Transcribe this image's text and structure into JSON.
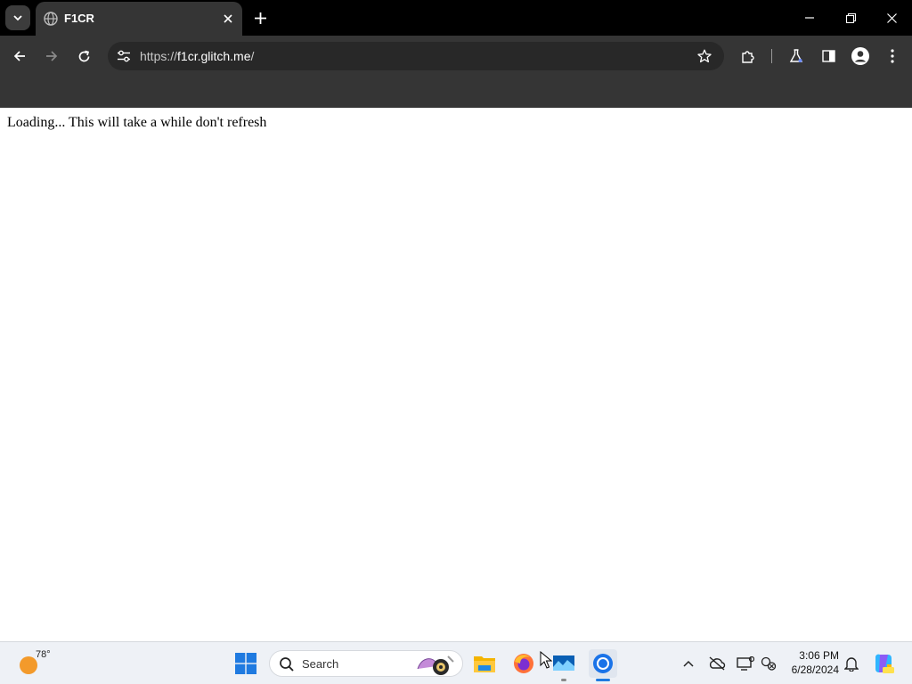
{
  "browser": {
    "tab": {
      "title": "F1CR"
    },
    "url": {
      "scheme": "https://",
      "host": "f1cr.glitch.me",
      "path": "/"
    }
  },
  "page": {
    "loading_message": "Loading... This will take a while don't refresh"
  },
  "taskbar": {
    "weather": {
      "temp": "78°"
    },
    "search": {
      "placeholder": "Search"
    },
    "clock": {
      "time": "3:06 PM",
      "date": "6/28/2024"
    }
  },
  "colors": {
    "titlebar_bg": "#000000",
    "toolbar_bg": "#353535",
    "omnibox_bg": "#282828",
    "page_bg": "#ffffff",
    "taskbar_bg": "#eef1f6",
    "windows_blue": "#1f7ae0"
  },
  "icons": [
    "tab-search-icon",
    "globe-icon",
    "close-icon",
    "plus-icon",
    "minimize-icon",
    "restore-icon",
    "back-icon",
    "forward-icon",
    "reload-icon",
    "site-info-icon",
    "star-icon",
    "extensions-icon",
    "labs-icon",
    "side-panel-icon",
    "profile-icon",
    "menu-icon",
    "windows-start-icon",
    "search-icon",
    "file-explorer-icon",
    "firefox-icon",
    "photos-icon",
    "chrome-icon",
    "chevron-up-icon",
    "onedrive-icon",
    "display-icon",
    "network-icon",
    "bell-icon",
    "copilot-icon"
  ]
}
